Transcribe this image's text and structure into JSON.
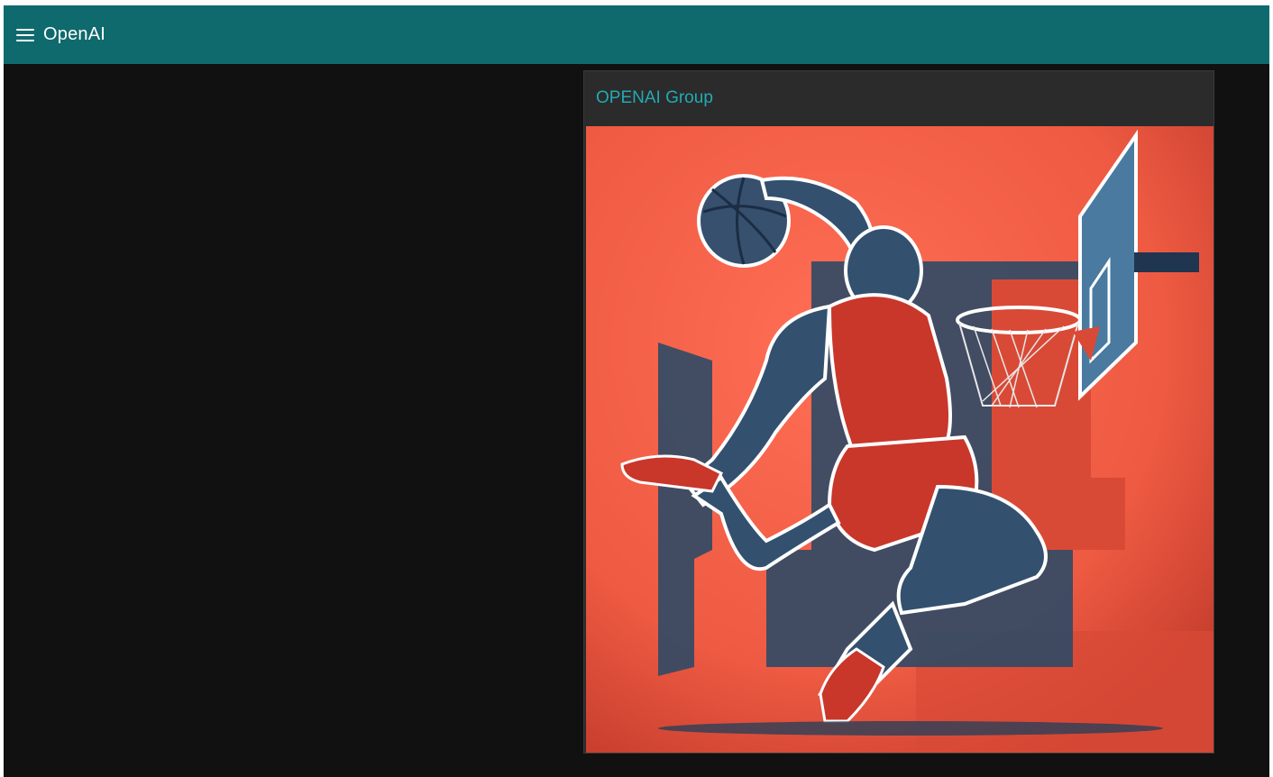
{
  "app": {
    "title": "OpenAI",
    "menu_icon": "menu-icon"
  },
  "card": {
    "title": "OPENAI Group",
    "image_alt": "Illustration of a basketball player dunking"
  },
  "colors": {
    "appbar": "#0f6a6d",
    "background": "#111111",
    "card": "#2b2b2b",
    "card_title": "#22aab4",
    "image_red": "#f06048",
    "image_navy": "#2e4a66"
  }
}
